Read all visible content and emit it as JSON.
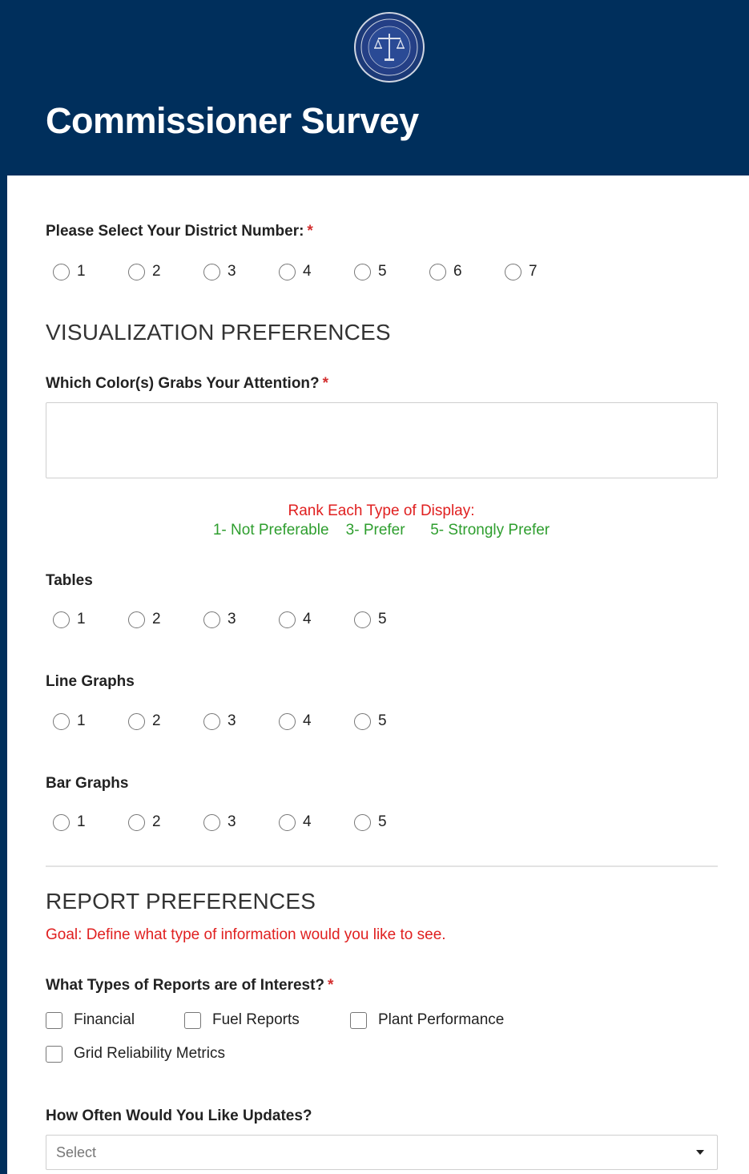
{
  "header": {
    "title": "Commissioner Survey",
    "logo_icon": "seal-scales-icon",
    "background_color": "#002f5c"
  },
  "district": {
    "label": "Please Select Your District Number:",
    "required_mark": "*",
    "options": [
      "1",
      "2",
      "3",
      "4",
      "5",
      "6",
      "7"
    ]
  },
  "visualization": {
    "section_title": "VISUALIZATION PREFERENCES",
    "color_question": {
      "label": "Which Color(s) Grabs Your Attention?",
      "required_mark": "*",
      "value": ""
    },
    "rank_title": "Rank Each Type of Display:",
    "rank_legend": "1- Not Preferable    3- Prefer      5- Strongly Prefer",
    "rank_questions": [
      {
        "label": "Tables",
        "options": [
          "1",
          "2",
          "3",
          "4",
          "5"
        ]
      },
      {
        "label": "Line Graphs",
        "options": [
          "1",
          "2",
          "3",
          "4",
          "5"
        ]
      },
      {
        "label": "Bar Graphs",
        "options": [
          "1",
          "2",
          "3",
          "4",
          "5"
        ]
      }
    ]
  },
  "reports": {
    "section_title": "REPORT PREFERENCES",
    "goal": "Goal: Define what type of information would you like to see.",
    "types_question": {
      "label": "What Types of Reports are of Interest?",
      "required_mark": "*",
      "options": [
        "Financial",
        "Fuel Reports",
        "Plant Performance",
        "Grid Reliability Metrics"
      ]
    },
    "frequency_question": {
      "label": "How Often Would You Like Updates?",
      "placeholder": "Select"
    }
  },
  "colors": {
    "accent_red": "#e02020",
    "legend_green": "#2e9e2e",
    "required_red": "#d32f2f"
  }
}
